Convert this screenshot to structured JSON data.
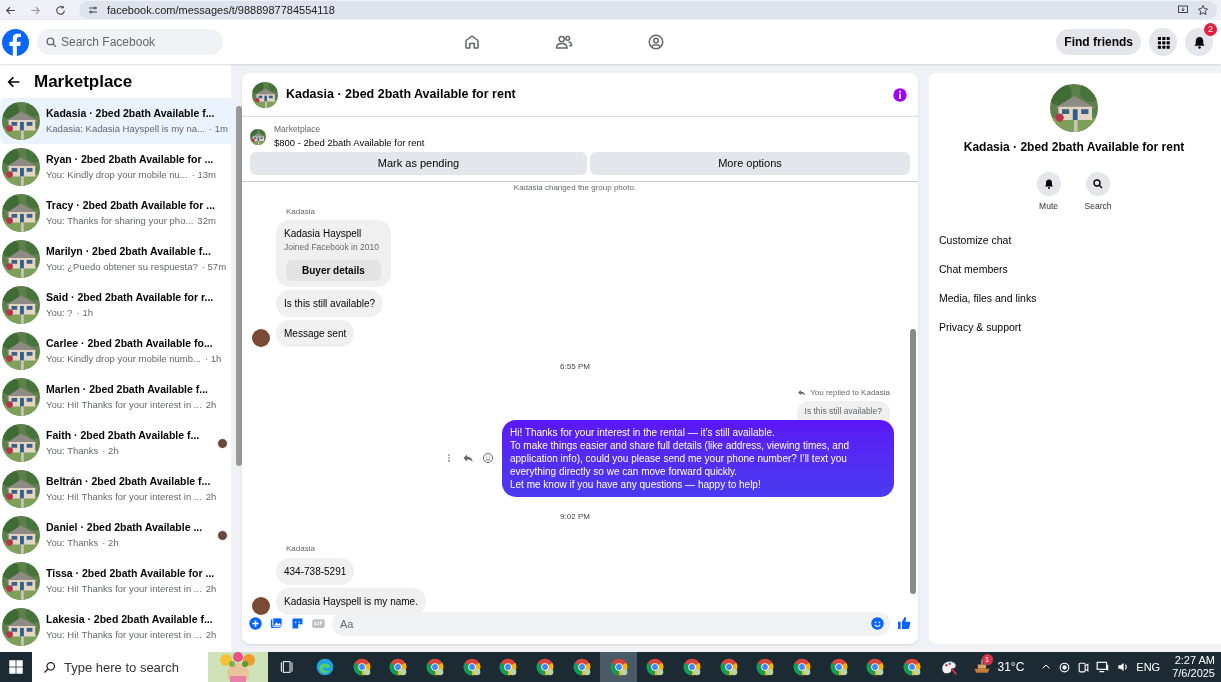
{
  "browser": {
    "url": "facebook.com/messages/t/9888987784554118"
  },
  "header": {
    "search_placeholder": "Search Facebook",
    "find_friends": "Find friends",
    "notification_count": "2"
  },
  "sidebar": {
    "title": "Marketplace",
    "conversations": [
      {
        "title": "Kadasia · 2bed 2bath Available f...",
        "preview": "Kadasia: Kadasia Hayspell is my na...",
        "time": "· 1m",
        "selected": true,
        "read_receipt": false
      },
      {
        "title": "Ryan · 2bed 2bath Available for ...",
        "preview": "You: Kindly drop your mobile nu...",
        "time": "· 13m",
        "selected": false,
        "read_receipt": false
      },
      {
        "title": "Tracy · 2bed 2bath Available for ...",
        "preview": "You: Thanks for sharing your pho...",
        "time": "32m",
        "selected": false,
        "read_receipt": false
      },
      {
        "title": "Marilyn · 2bed 2bath Available f...",
        "preview": "You: ¿Puedo obtener su respuesta?",
        "time": "· 57m",
        "selected": false,
        "read_receipt": false
      },
      {
        "title": "Said · 2bed 2bath Available for r...",
        "preview": "You: ?",
        "time": "· 1h",
        "selected": false,
        "read_receipt": false
      },
      {
        "title": "Carlee · 2bed 2bath Available fo...",
        "preview": "You: Kindly drop your mobile numb...",
        "time": "· 1h",
        "selected": false,
        "read_receipt": false
      },
      {
        "title": "Marlen · 2bed 2bath Available f...",
        "preview": "You: Hi! Thanks for your interest in ...",
        "time": "2h",
        "selected": false,
        "read_receipt": false
      },
      {
        "title": "Faith · 2bed 2bath Available f...",
        "preview": "You: Thanks",
        "time": "· 2h",
        "selected": false,
        "read_receipt": true
      },
      {
        "title": "Beltrán · 2bed 2bath Available f...",
        "preview": "You: Hi! Thanks for your interest in ...",
        "time": "2h",
        "selected": false,
        "read_receipt": false
      },
      {
        "title": "Daniel · 2bed 2bath Available ...",
        "preview": "You: Thanks",
        "time": "· 2h",
        "selected": false,
        "read_receipt": true
      },
      {
        "title": "Tissa · 2bed 2bath Available for ...",
        "preview": "You: Hi! Thanks for your interest in ...",
        "time": "2h",
        "selected": false,
        "read_receipt": false
      },
      {
        "title": "Lakesia · 2bed 2bath Available f...",
        "preview": "You: Hi! Thanks for your interest in ...",
        "time": "2h",
        "selected": false,
        "read_receipt": false
      }
    ]
  },
  "chat": {
    "title": "Kadasia · 2bed 2bath Available for rent",
    "listing": {
      "label": "Marketplace",
      "text": "$800 - 2bed 2bath Available for rent"
    },
    "actions": [
      "Mark as pending",
      "More options"
    ],
    "messages": [
      {
        "kind": "system",
        "text": "Kadasia changed the group photo."
      },
      {
        "kind": "sender",
        "text": "Kadasia"
      },
      {
        "kind": "profile_card",
        "name": "Kadasia Hayspell",
        "subtitle": "Joined Facebook in 2010",
        "button": "Buyer details"
      },
      {
        "kind": "incoming",
        "text": "Is this still available?",
        "avatar": false
      },
      {
        "kind": "incoming",
        "text": "Message sent",
        "avatar": true
      },
      {
        "kind": "time",
        "text": "6:55 PM"
      },
      {
        "kind": "reply_context",
        "label": "You replied to Kadasia",
        "quote": "Is this still available?"
      },
      {
        "kind": "outgoing",
        "text": "Hi! Thanks for your interest in the rental — it’s still available.\nTo make things easier and share full details (like address, viewing times, and application info), could you please send me your phone number? I’ll text you everything directly so we can move forward quickly.\nLet me know if you have any questions — happy to help!"
      },
      {
        "kind": "time",
        "text": "9:02 PM"
      },
      {
        "kind": "sender",
        "text": "Kadasia"
      },
      {
        "kind": "incoming",
        "text": "434-738-5291",
        "avatar": false
      },
      {
        "kind": "incoming",
        "text": "Kadasia Hayspell is my name.",
        "avatar": true
      }
    ],
    "composer_placeholder": "Aa"
  },
  "details": {
    "title": "Kadasia · 2bed 2bath Available for rent",
    "actions": [
      {
        "kind": "bell",
        "label": "Mute"
      },
      {
        "kind": "search",
        "label": "Search"
      }
    ],
    "menu": [
      "Customize chat",
      "Chat members",
      "Media, files and links",
      "Privacy & support"
    ]
  },
  "taskbar": {
    "search_placeholder": "Type here to search",
    "apps": [
      {
        "kind": "taskview",
        "selected": false
      },
      {
        "kind": "edge",
        "selected": false
      },
      {
        "kind": "chrome",
        "selected": false
      },
      {
        "kind": "chrome",
        "selected": false
      },
      {
        "kind": "chrome",
        "selected": false
      },
      {
        "kind": "chrome",
        "selected": false
      },
      {
        "kind": "chrome",
        "selected": false
      },
      {
        "kind": "chrome",
        "selected": false
      },
      {
        "kind": "chrome",
        "selected": false
      },
      {
        "kind": "chrome",
        "selected": true
      },
      {
        "kind": "chrome",
        "selected": false
      },
      {
        "kind": "chrome",
        "selected": false
      },
      {
        "kind": "chrome",
        "selected": false
      },
      {
        "kind": "chrome",
        "selected": false
      },
      {
        "kind": "chrome",
        "selected": false
      },
      {
        "kind": "chrome",
        "selected": false
      },
      {
        "kind": "chrome",
        "selected": false
      },
      {
        "kind": "chrome",
        "selected": false
      },
      {
        "kind": "paint",
        "selected": false
      }
    ],
    "weather_badge": "1",
    "temperature": "31°C",
    "language": "ENG",
    "time": "2:27 AM",
    "date": "7/6/2025"
  }
}
